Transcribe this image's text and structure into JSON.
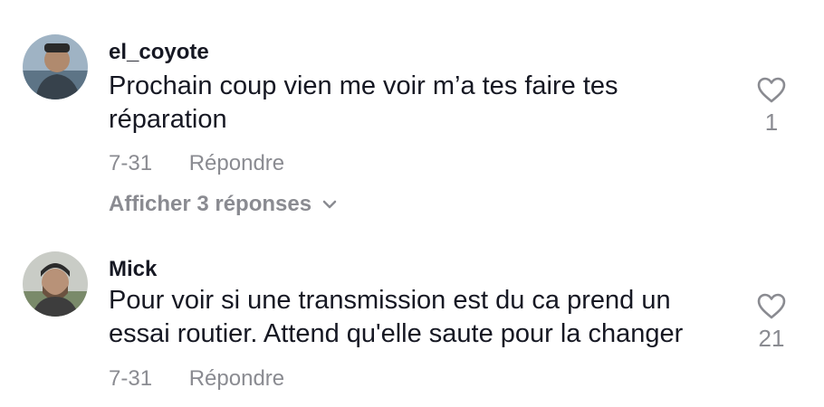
{
  "comments": [
    {
      "username": "el_coyote",
      "text": "Prochain coup vien me voir m’a tes faire tes réparation",
      "date": "7-31",
      "reply_label": "Répondre",
      "like_count": "1",
      "view_replies_label": "Afficher 3 réponses"
    },
    {
      "username": "Mick",
      "text": "Pour voir si une transmission est du ca prend un essai routier. Attend qu'elle saute pour la changer",
      "date": "7-31",
      "reply_label": "Répondre",
      "like_count": "21"
    }
  ],
  "icons": {
    "like": "heart-outline-icon",
    "expand": "chevron-down-icon"
  },
  "colors": {
    "primary_text": "#161823",
    "secondary_text": "#8a8b91"
  }
}
